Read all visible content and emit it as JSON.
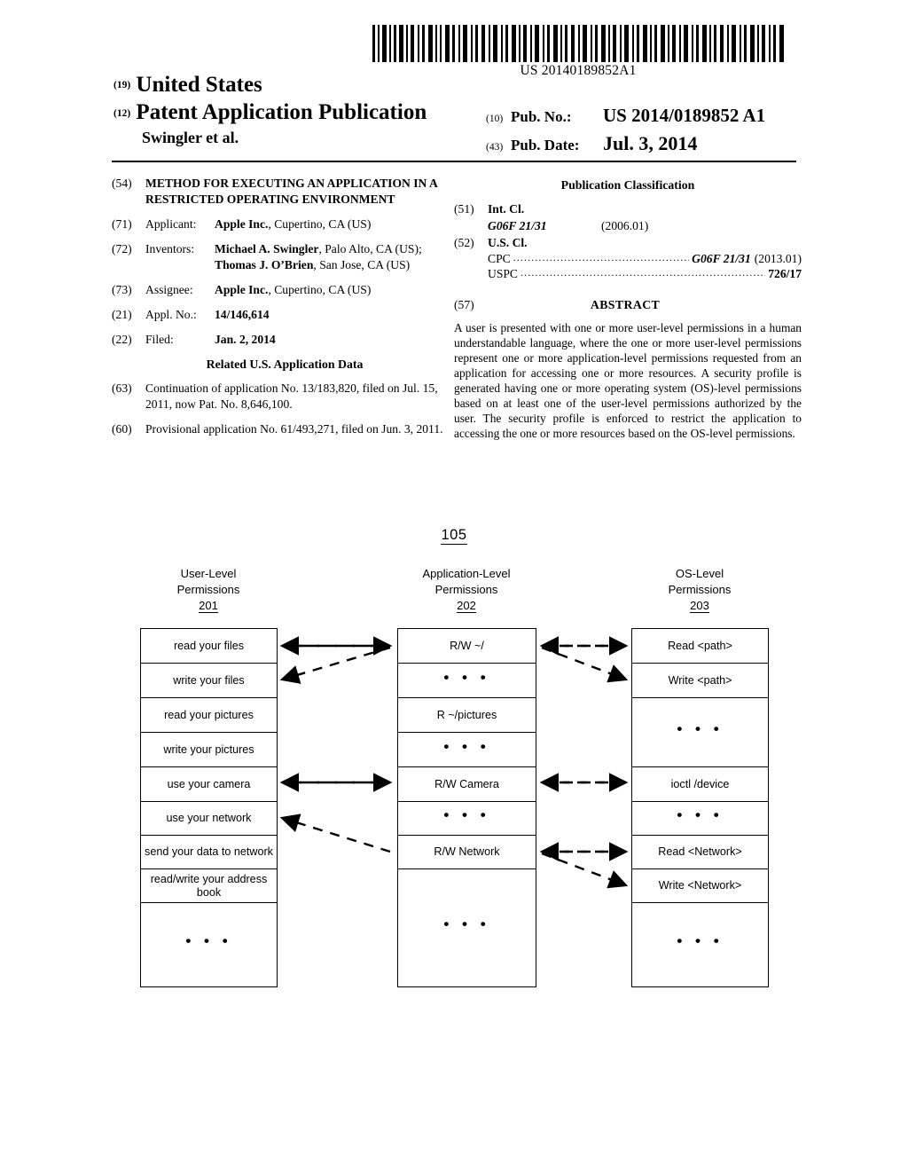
{
  "header": {
    "barcode_number": "US 20140189852A1",
    "country_code": "(19)",
    "country": "United States",
    "pub_type_code": "(12)",
    "pub_type": "Patent Application Publication",
    "inventor_short": "Swingler et al.",
    "pub_no_code": "(10)",
    "pub_no_label": "Pub. No.:",
    "pub_no_value": "US 2014/0189852 A1",
    "pub_date_code": "(43)",
    "pub_date_label": "Pub. Date:",
    "pub_date_value": "Jul. 3, 2014"
  },
  "biblio_left": {
    "title_code": "(54)",
    "title": "METHOD FOR EXECUTING AN APPLICATION IN A RESTRICTED OPERATING ENVIRONMENT",
    "applicant_code": "(71)",
    "applicant_label": "Applicant:",
    "applicant_name": "Apple Inc.",
    "applicant_rest": ", Cupertino, CA (US)",
    "inventors_code": "(72)",
    "inventors_label": "Inventors:",
    "inventor1_name": "Michael A. Swingler",
    "inventor1_rest": ", Palo Alto, CA (US); ",
    "inventor2_name": "Thomas J. O’Brien",
    "inventor2_rest": ", San Jose, CA (US)",
    "assignee_code": "(73)",
    "assignee_label": "Assignee:",
    "assignee_name": "Apple Inc.",
    "assignee_rest": ", Cupertino, CA (US)",
    "appl_no_code": "(21)",
    "appl_no_label": "Appl. No.:",
    "appl_no_value": "14/146,614",
    "filed_code": "(22)",
    "filed_label": "Filed:",
    "filed_value": "Jan. 2, 2014",
    "related_heading": "Related U.S. Application Data",
    "continuation_code": "(63)",
    "continuation_text": "Continuation of application No. 13/183,820, filed on Jul. 15, 2011, now Pat. No. 8,646,100.",
    "provisional_code": "(60)",
    "provisional_text": "Provisional application No. 61/493,271, filed on Jun. 3, 2011."
  },
  "biblio_right": {
    "classification_heading": "Publication Classification",
    "int_cl_code": "(51)",
    "int_cl_label": "Int. Cl.",
    "int_cl_value": "G06F 21/31",
    "int_cl_date": "(2006.01)",
    "us_cl_code": "(52)",
    "us_cl_label": "U.S. Cl.",
    "cpc_name": "CPC",
    "cpc_value": "G06F 21/31",
    "cpc_date": "(2013.01)",
    "uspc_name": "USPC",
    "uspc_value": "726/17",
    "abstract_code": "(57)",
    "abstract_heading": "ABSTRACT",
    "abstract_text": "A user is presented with one or more user-level permissions in a human understandable language, where the one or more user-level permissions represent one or more application-level permissions requested from an application for accessing one or more resources. A security profile is generated having one or more operating system (OS)-level permissions based on at least one of the user-level permissions authorized by the user. The security profile is enforced to restrict the application to accessing the one or more resources based on the OS-level permissions."
  },
  "figure": {
    "figure_id": "105",
    "ellipsis": "• • •",
    "columns": [
      {
        "header_line1": "User-Level",
        "header_line2": "Permissions",
        "ref": "201",
        "cells": [
          "read your files",
          "write your files",
          "read your pictures",
          "write your pictures",
          "use your camera",
          "use your network",
          "send your data to network",
          "read/write your address book"
        ]
      },
      {
        "header_line1": "Application-Level",
        "header_line2": "Permissions",
        "ref": "202",
        "cells": [
          "R/W ~/",
          "• • •",
          "R ~/pictures",
          "• • •",
          "R/W Camera",
          "• • •",
          "R/W Network"
        ]
      },
      {
        "header_line1": "OS-Level",
        "header_line2": "Permissions",
        "ref": "203",
        "cells": [
          "Read <path>",
          "Write <path>",
          "• • •",
          "ioctl /device",
          "• • •",
          "Read <Network>",
          "Write <Network>"
        ]
      }
    ]
  }
}
